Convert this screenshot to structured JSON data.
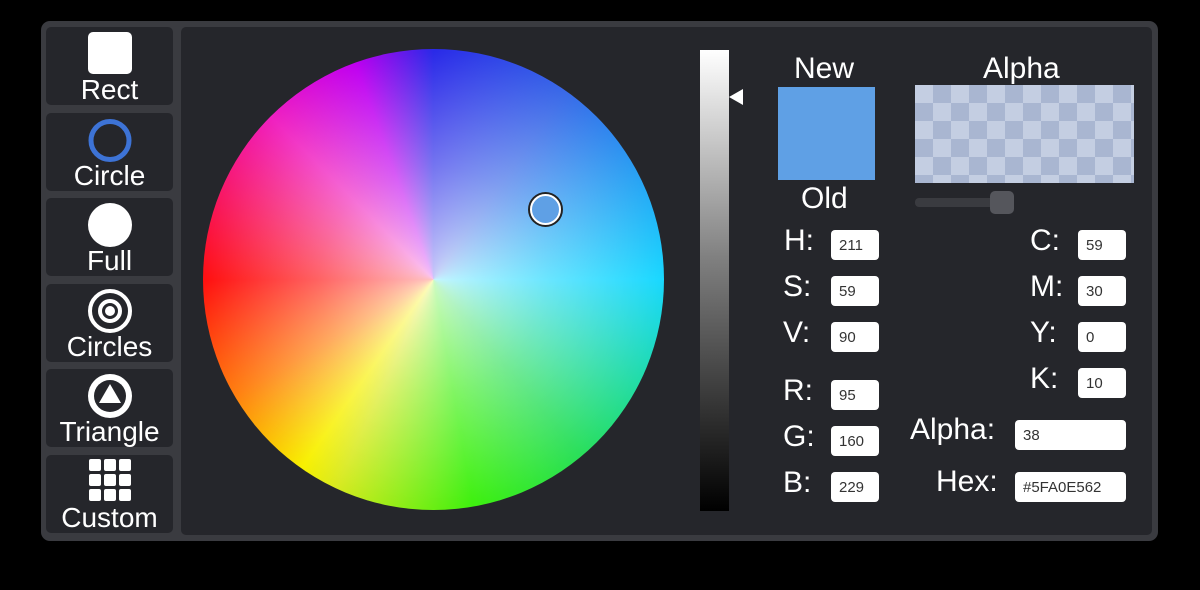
{
  "modes": [
    {
      "label": "Rect",
      "icon": "rect-icon"
    },
    {
      "label": "Circle",
      "icon": "circle-outline-icon"
    },
    {
      "label": "Full",
      "icon": "full-circle-icon"
    },
    {
      "label": "Circles",
      "icon": "concentric-circles-icon"
    },
    {
      "label": "Triangle",
      "icon": "triangle-in-circle-icon"
    },
    {
      "label": "Custom",
      "icon": "grid-icon"
    }
  ],
  "selected_mode": "Circle",
  "preview": {
    "new_label": "New",
    "old_label": "Old",
    "alpha_label": "Alpha",
    "new_color": "#5FA0E5"
  },
  "alpha_slider": {
    "value": 38,
    "max": 255
  },
  "fields": {
    "h": {
      "label": "H:",
      "value": "211"
    },
    "s": {
      "label": "S:",
      "value": "59"
    },
    "v": {
      "label": "V:",
      "value": "90"
    },
    "r": {
      "label": "R:",
      "value": "95"
    },
    "g": {
      "label": "G:",
      "value": "160"
    },
    "b": {
      "label": "B:",
      "value": "229"
    },
    "c": {
      "label": "C:",
      "value": "59"
    },
    "m": {
      "label": "M:",
      "value": "30"
    },
    "y": {
      "label": "Y:",
      "value": "0"
    },
    "k": {
      "label": "K:",
      "value": "10"
    },
    "alpha": {
      "label": "Alpha:",
      "value": "38"
    },
    "hex": {
      "label": "Hex:",
      "value": "#5FA0E562"
    }
  },
  "colors": {
    "accent": "#3d73d6",
    "panel_bg": "#25262b",
    "frame_bg": "#3a3b40"
  }
}
